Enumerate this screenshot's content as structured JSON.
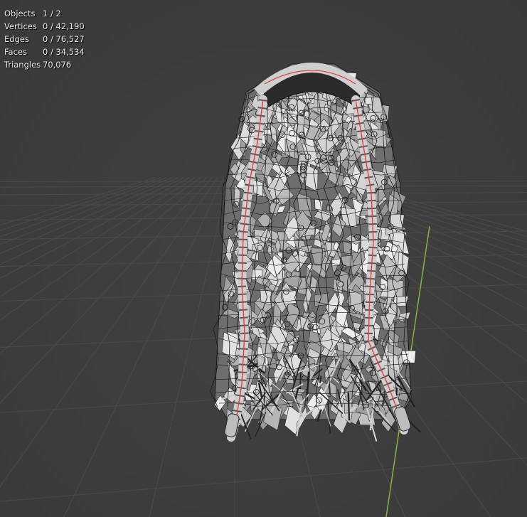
{
  "overlay": {
    "stats": [
      {
        "label": "Objects",
        "value": "1 / 2"
      },
      {
        "label": "Vertices",
        "value": "0 / 42,190"
      },
      {
        "label": "Edges",
        "value": "0 / 76,527"
      },
      {
        "label": "Faces",
        "value": "0 / 34,534"
      },
      {
        "label": "Triangles",
        "value": "70,076"
      }
    ]
  },
  "colors": {
    "background": "#3d3d3d",
    "grid": "#4a4a4a",
    "y_axis": "#8ab238",
    "mesh_light": "#d8d8d8",
    "mesh_dark": "#1a1a1a",
    "seam": "#e0423a"
  },
  "viewport": {
    "object": "hair-mesh",
    "mode": "object-mode-wireframe-overlay"
  }
}
